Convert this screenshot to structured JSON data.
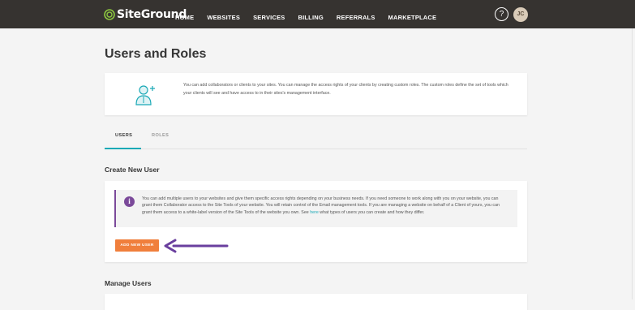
{
  "brand": {
    "name": "SiteGround"
  },
  "nav": {
    "items": [
      "HOME",
      "WEBSITES",
      "SERVICES",
      "BILLING",
      "REFERRALS",
      "MARKETPLACE"
    ],
    "help": "?",
    "avatar_initials": "JC"
  },
  "page": {
    "title": "Users and Roles",
    "intro": "You can add collaborators or clients to your sites. You can manage the access rights of your clients by creating custom roles. The custom roles define the set of tools which your clients will see and have access to in their sites's management interface."
  },
  "tabs": {
    "users": "USERS",
    "roles": "ROLES",
    "active": "USERS"
  },
  "create_user": {
    "title": "Create New User",
    "notice_before_link": "You can add multiple users to your websites and give them specific access rights depending on your business needs. If you need someone to work along with you on your website, you can grant them Collaborator access to the Site Tools of your website. You will retain control of the Email management tools. If you are managing a website on behalf of a Client of yours, you can grant them access to a white-label version of the Site Tools of the website you own. See ",
    "notice_link": "here",
    "notice_after_link": " what types of users you can create and how they differ.",
    "button_label": "ADD NEW USER"
  },
  "manage_users": {
    "title": "Manage Users"
  },
  "colors": {
    "topbar": "#363330",
    "accent_teal": "#1ba9b6",
    "button_orange": "#f07f3c",
    "notice_purple": "#7b4a9a",
    "arrow_purple": "#6a3f9e",
    "logo_green": "#8cc63f"
  },
  "icons": {
    "logo": "siteground-logo-icon",
    "intro": "add-user-icon",
    "notice": "info-icon",
    "pointer": "arrow-left-icon"
  }
}
